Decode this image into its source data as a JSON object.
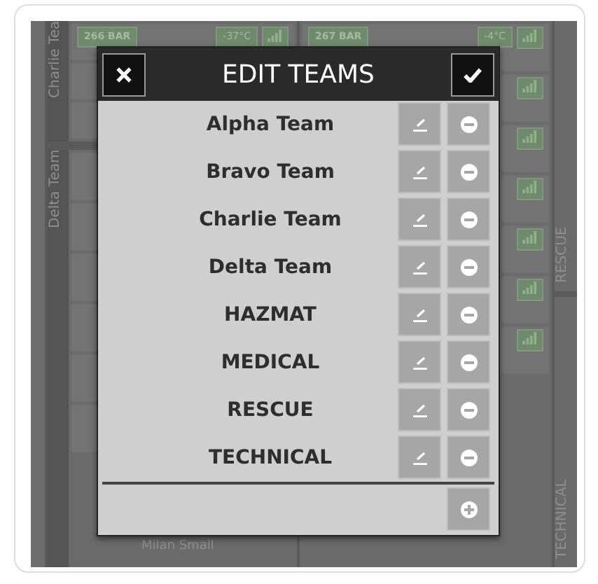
{
  "background": {
    "left_column": {
      "label": "Charlie Tea",
      "tile": {
        "reading": "266 BAR",
        "temperature": "-37°C"
      }
    },
    "right_column": {
      "tile": {
        "reading": "267 BAR",
        "temperature": "-4°C"
      }
    },
    "lower_column": {
      "label": "Delta Team",
      "person": "Milan Small"
    },
    "side_labels": [
      "RESCUE",
      "TECHNICAL"
    ]
  },
  "dialog": {
    "title": "EDIT TEAMS",
    "teams": [
      "Alpha Team",
      "Bravo Team",
      "Charlie Team",
      "Delta Team",
      "HAZMAT",
      "MEDICAL",
      "RESCUE",
      "TECHNICAL"
    ]
  }
}
